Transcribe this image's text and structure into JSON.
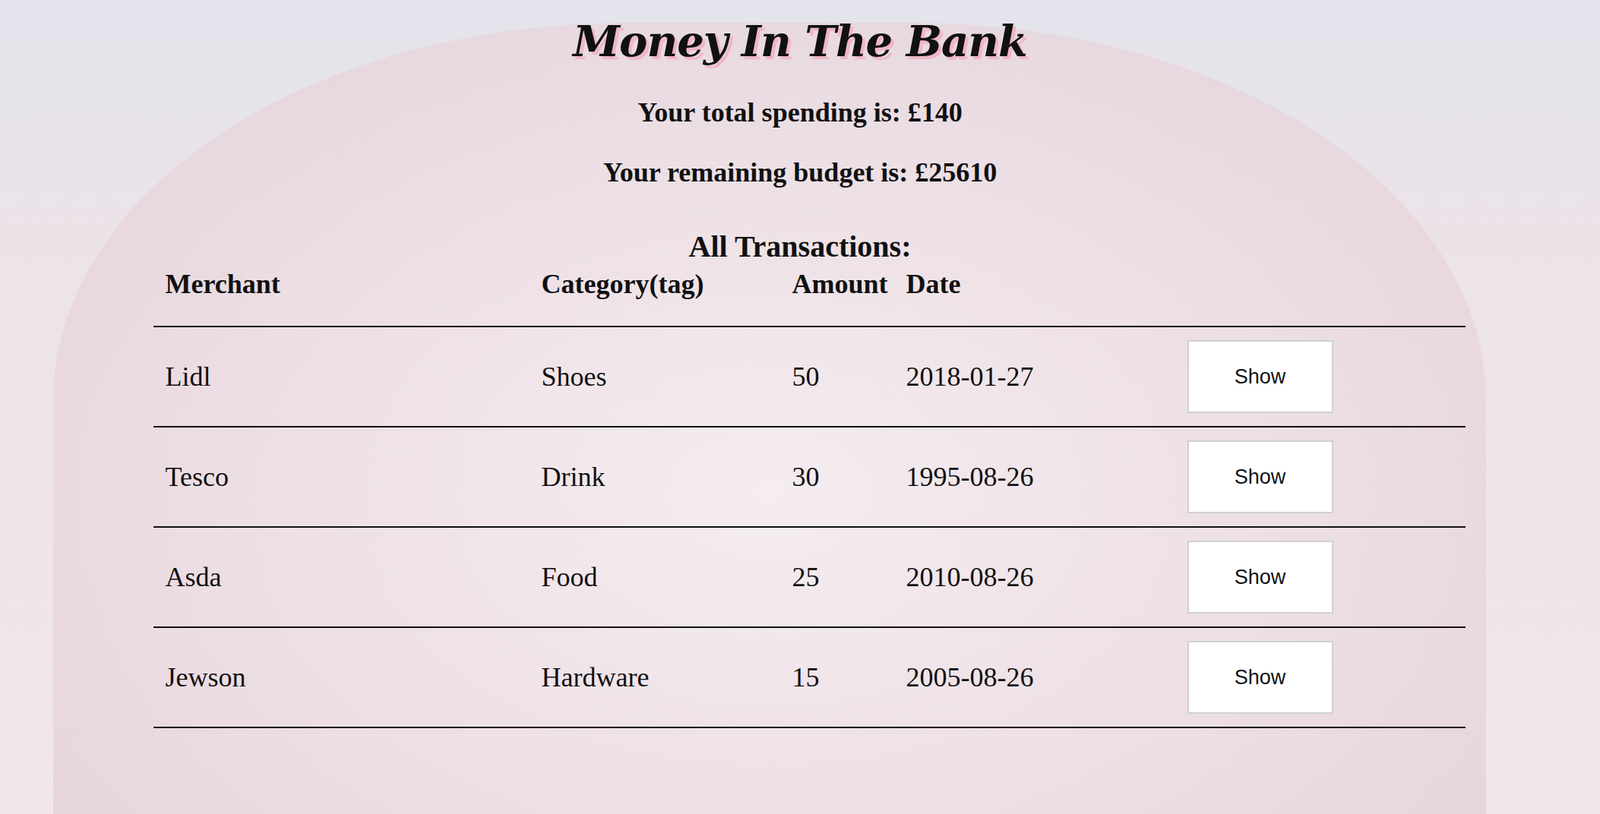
{
  "window": {
    "title": "Money In The Bank"
  },
  "summary": {
    "spending": "Your total spending is: £140",
    "budget": "Your remaining budget is: £25610"
  },
  "table": {
    "title": "All Transactions:",
    "columns": [
      "Merchant",
      "Category(tag)",
      "Amount",
      "Date"
    ],
    "rows": [
      {
        "merchant": "Lidl",
        "category": "Shoes",
        "amount": "50",
        "date": "2018-01-27",
        "action": "Show"
      },
      {
        "merchant": "Tesco",
        "category": "Drink",
        "amount": "30",
        "date": "1995-08-26",
        "action": "Show"
      },
      {
        "merchant": "Asda",
        "category": "Food",
        "amount": "25",
        "date": "2010-08-26",
        "action": "Show"
      },
      {
        "merchant": "Jewson",
        "category": "Hardware",
        "amount": "15",
        "date": "2005-08-26",
        "action": "Show"
      }
    ]
  }
}
